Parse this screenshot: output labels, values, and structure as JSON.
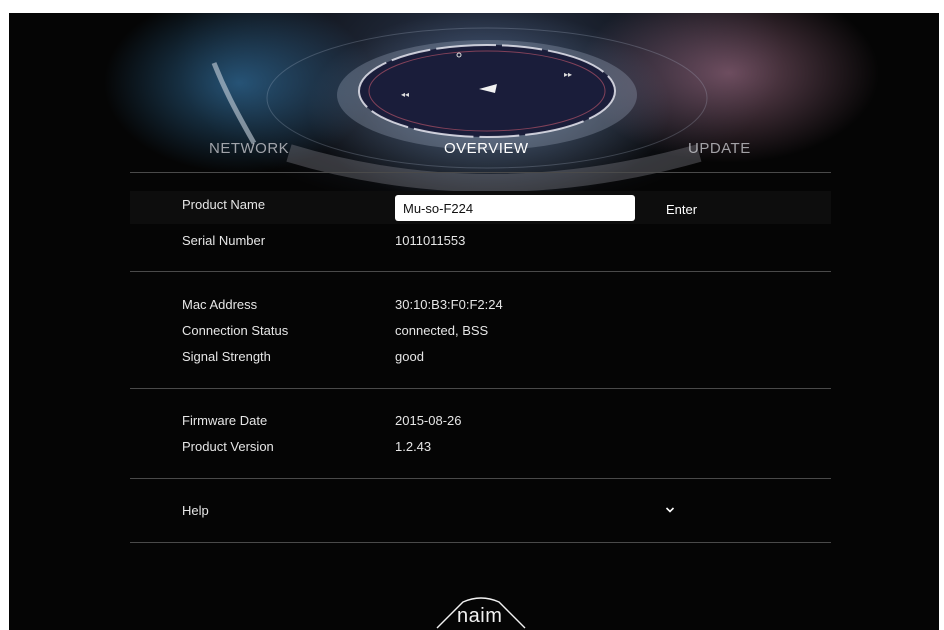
{
  "tabs": [
    {
      "label": "NETWORK",
      "active": false
    },
    {
      "label": "OVERVIEW",
      "active": true
    },
    {
      "label": "UPDATE",
      "active": false
    }
  ],
  "product": {
    "name_label": "Product Name",
    "name_value": "Mu-so-F224",
    "enter_label": "Enter",
    "serial_label": "Serial Number",
    "serial_value": "1011011553"
  },
  "network": {
    "mac_label": "Mac Address",
    "mac_value": "30:10:B3:F0:F2:24",
    "status_label": "Connection Status",
    "status_value": "connected, BSS",
    "signal_label": "Signal Strength",
    "signal_value": "good"
  },
  "firmware": {
    "date_label": "Firmware Date",
    "date_value": "2015-08-26",
    "version_label": "Product Version",
    "version_value": "1.2.43"
  },
  "help": {
    "label": "Help",
    "toggle_icon": "chevron-down-icon"
  },
  "brand": {
    "logo_text": "naim"
  },
  "colors": {
    "background": "#050505",
    "divider": "#4a4a4a",
    "text": "#e6e6e6",
    "input_bg": "#ffffff"
  }
}
